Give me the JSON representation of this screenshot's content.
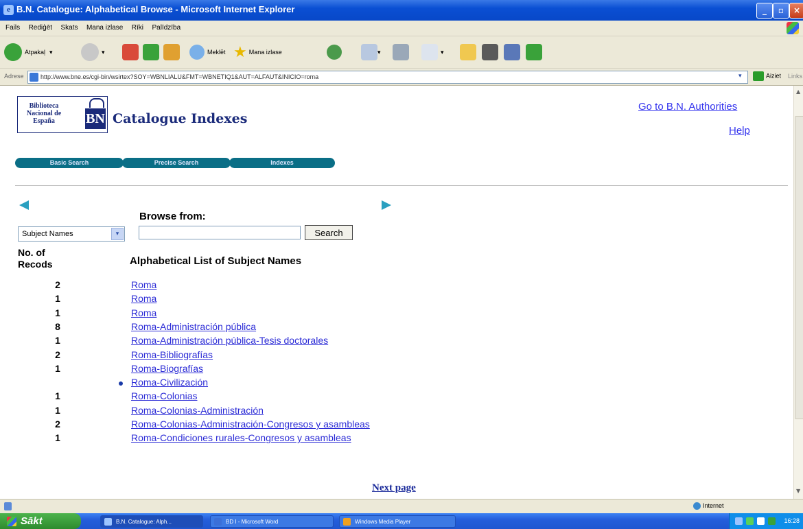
{
  "window": {
    "title": "B.N. Catalogue: Alphabetical Browse - Microsoft Internet Explorer"
  },
  "menu": [
    "Fails",
    "Rediģēt",
    "Skats",
    "Mana izlase",
    "Rīki",
    "Palīdzība"
  ],
  "toolbar": {
    "back_label": "Atpakaļ",
    "search_label": "Meklēt",
    "favorites_label": "Mana izlase"
  },
  "address": {
    "label": "Adrese",
    "url": "http://www.bne.es/cgi-bin/wsirtex?SOY=WBNLIALU&FMT=WBNETIQ1&AUT=ALFAUT&INICIO=roma",
    "go_label": "Aiziet",
    "links_label": "Links"
  },
  "header": {
    "logo_text": "Biblioteca Nacional de España",
    "logo_bn": "BN",
    "title": "Catalogue Indexes",
    "authorities_link": "Go to B.N. Authorities",
    "help_link": "Help"
  },
  "nav": {
    "basic": "Basic Search",
    "precise": "Precise Search",
    "indexes": "Indexes"
  },
  "browse": {
    "label": "Browse from:",
    "select_value": "Subject Names",
    "search_value": "",
    "search_button": "Search"
  },
  "list": {
    "count_header": "No. of Recods",
    "title": "Alphabetical List of Subject Names",
    "rows": [
      {
        "count": "2",
        "term": "Roma"
      },
      {
        "count": "1",
        "term": "Roma"
      },
      {
        "count": "1",
        "term": "Roma"
      },
      {
        "count": "8",
        "term": "Roma-Administración pública"
      },
      {
        "count": "1",
        "term": "Roma-Administración pública-Tesis doctorales"
      },
      {
        "count": "2",
        "term": "Roma-Bibliografías"
      },
      {
        "count": "1",
        "term": "Roma-Biografías"
      },
      {
        "count": "",
        "term": "Roma-Civilización",
        "bullet": true
      },
      {
        "count": "1",
        "term": "Roma-Colonias"
      },
      {
        "count": "1",
        "term": "Roma-Colonias-Administración"
      },
      {
        "count": "2",
        "term": "Roma-Colonias-Administración-Congresos y asambleas"
      },
      {
        "count": "1",
        "term": "Roma-Condiciones rurales-Congresos y asambleas"
      }
    ],
    "next_page": "Next page"
  },
  "status": {
    "zone": "Internet"
  },
  "taskbar": {
    "start": "Sākt",
    "tasks": [
      "B.N. Catalogue: Alph...",
      "BD I - Microsoft Word",
      "Windows Media Player"
    ],
    "clock": "16:28"
  },
  "colors": {
    "link": "#2b2bd6",
    "nav_button": "#0a6e86",
    "arrow": "#2aa0c0",
    "titlebar": "#0a4fd3"
  }
}
